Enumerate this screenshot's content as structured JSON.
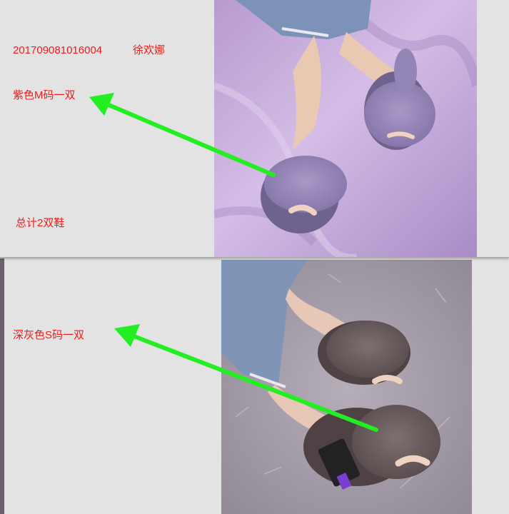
{
  "top": {
    "order_number": "201709081016004",
    "customer_name": "徐欢娜",
    "item_label": "紫色M码一双",
    "total_label": "总计2双鞋"
  },
  "bottom": {
    "item_label": "深灰色S码一双"
  },
  "colors": {
    "label_red": "#ee1c1c",
    "arrow_green": "#22ee22",
    "top_background": "#c8a8dc",
    "bottom_background": "#a8a0a8"
  }
}
